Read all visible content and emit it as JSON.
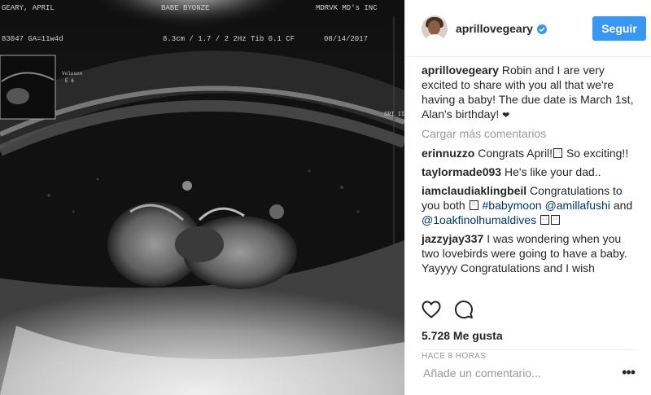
{
  "photo": {
    "overlay": {
      "patient": "GEARY, APRIL",
      "id_ga": "83047  GA=11w4d",
      "center": "BABE BYONZE",
      "clinic": "MDRVK MD's INC",
      "params": "8.3cm / 1.7 / 2 2Hz   Tib 0.1   CF",
      "date": "08/14/2017",
      "side_label": "Voluson",
      "side_sub": "E 6",
      "sri": "SRI II",
      "tiles": "3\n3\n5"
    }
  },
  "header": {
    "username": "aprillovegeary",
    "follow_label": "Seguir",
    "avatar_icon": "profile-avatar",
    "verified_icon": "verified-badge-icon",
    "accent": "#3897f0"
  },
  "caption": {
    "user": "aprillovegeary",
    "text": "Robin and I are very excited to share with you all that we're having a baby! The due date is March 1st, Alan's birthday!",
    "heart": "❤"
  },
  "load_more": "Cargar más comentarios",
  "comments": [
    {
      "user": "erinnuzzo",
      "text_a": "Congrats April!",
      "emoji_a": "⬚",
      "text_b": "So exciting!!"
    },
    {
      "user": "taylormade093",
      "text_a": "He's like your dad.."
    },
    {
      "user": "iamclaudiaklingbeil",
      "text_a": "Congratulations to you both",
      "emoji_a": "⬚",
      "tag_1": "#babymoon",
      "mention_1": "@amillafushi",
      "and": "and",
      "mention_2": "@1oakfinolhumaldives",
      "emoji_b": "⬚",
      "emoji_c": "⬚"
    },
    {
      "user": "jazzyjay337",
      "text_a": "I was wondering when you two lovebirds were going to have a baby. Yayyyy Congratulations and I wish"
    }
  ],
  "actions": {
    "like_icon": "heart-icon",
    "comment_icon": "comment-bubble-icon",
    "likes": "5.728 Me gusta",
    "time": "HACE 8 HORAS"
  },
  "add_comment": {
    "placeholder": "Añade un comentario...",
    "more_icon": "ellipsis-icon",
    "more": "•••"
  }
}
